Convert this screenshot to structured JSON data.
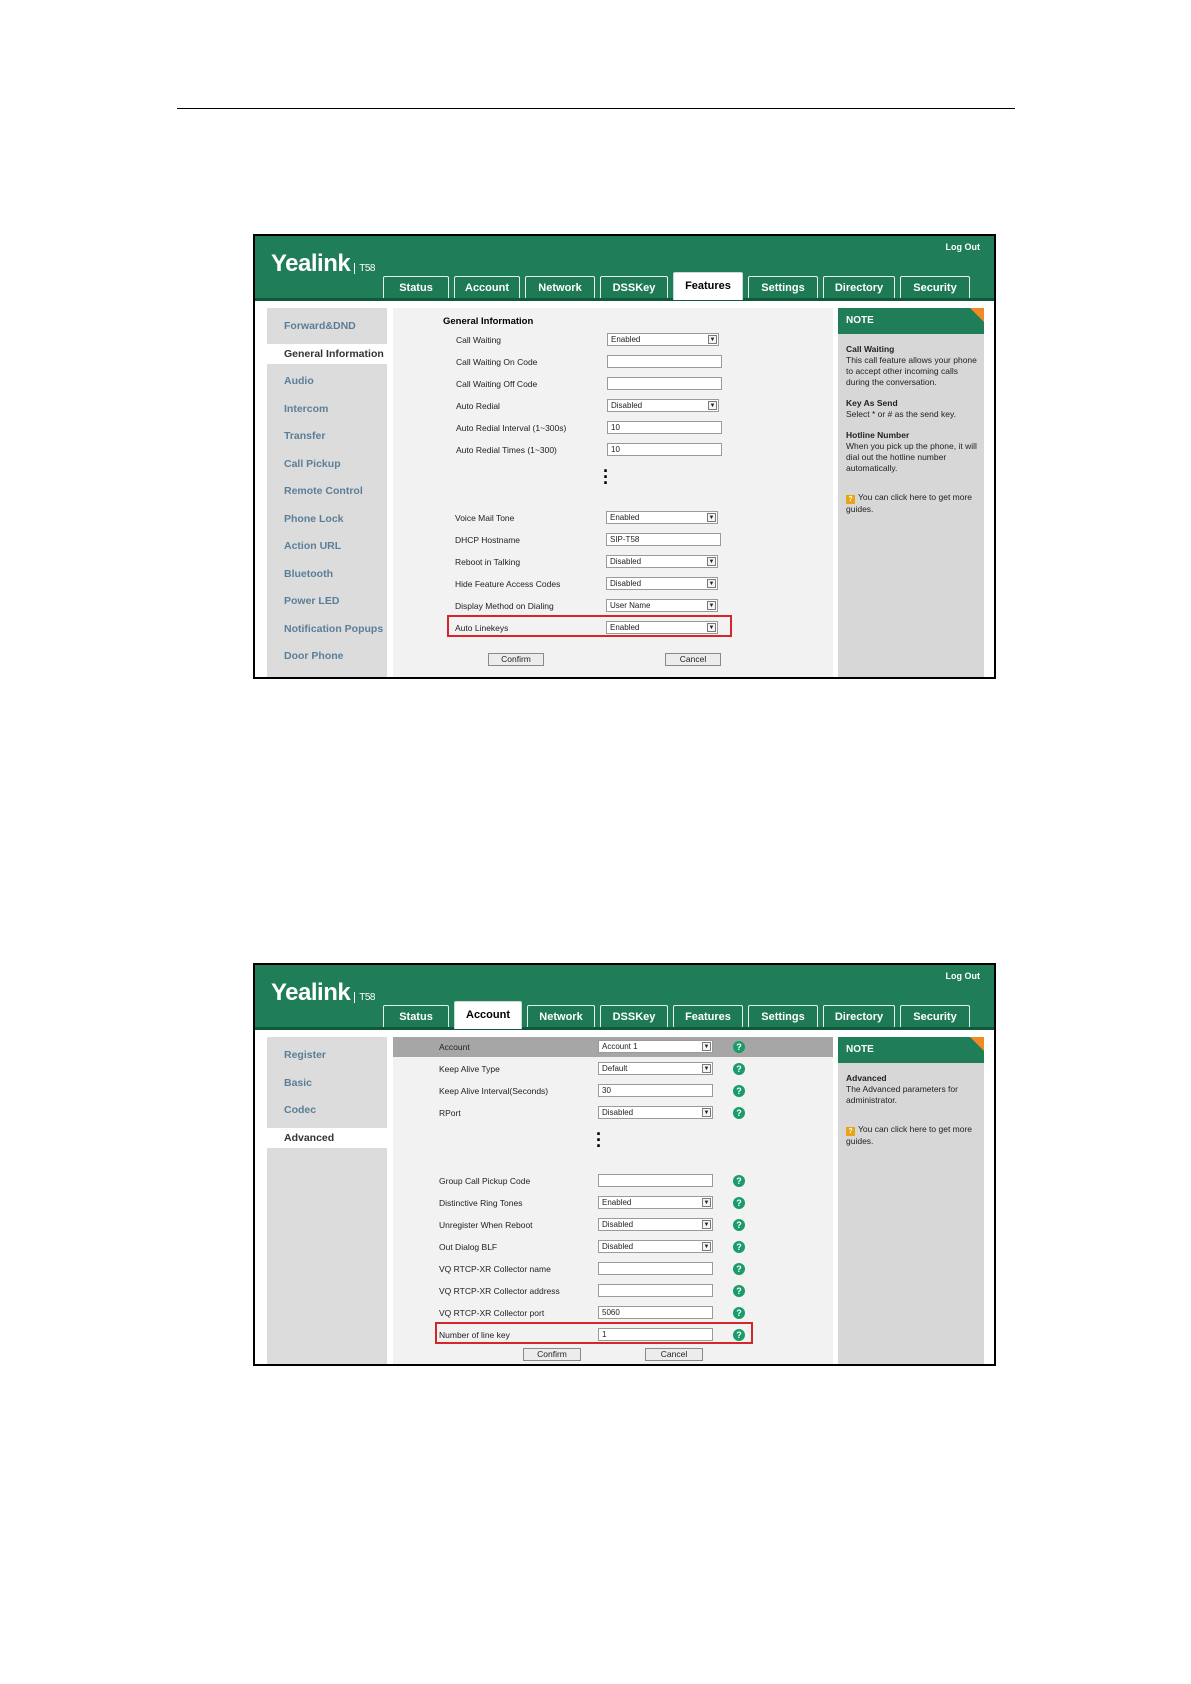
{
  "screenshot1": {
    "logo": "Yealink",
    "model": "T58",
    "logout": "Log Out",
    "tabs": [
      {
        "label": "Status"
      },
      {
        "label": "Account"
      },
      {
        "label": "Network"
      },
      {
        "label": "DSSKey"
      },
      {
        "label": "Features"
      },
      {
        "label": "Settings"
      },
      {
        "label": "Directory"
      },
      {
        "label": "Security"
      }
    ],
    "active_tab": "Features",
    "sidebar": [
      "Forward&DND",
      "General Information",
      "Audio",
      "Intercom",
      "Transfer",
      "Call Pickup",
      "Remote Control",
      "Phone Lock",
      "Action URL",
      "Bluetooth",
      "Power LED",
      "Notification Popups",
      "Door Phone"
    ],
    "sidebar_selected": "General Information",
    "section_title": "General Information",
    "rows": [
      {
        "label": "Call Waiting",
        "value": "Enabled",
        "type": "select"
      },
      {
        "label": "Call Waiting On Code",
        "value": "",
        "type": "input"
      },
      {
        "label": "Call Waiting Off Code",
        "value": "",
        "type": "input"
      },
      {
        "label": "Auto Redial",
        "value": "Disabled",
        "type": "select"
      },
      {
        "label": "Auto Redial Interval (1~300s)",
        "value": "10",
        "type": "input"
      },
      {
        "label": "Auto Redial Times (1~300)",
        "value": "10",
        "type": "input"
      },
      {
        "label": "Voice Mail Tone",
        "value": "Enabled",
        "type": "select"
      },
      {
        "label": "DHCP Hostname",
        "value": "SIP-T58",
        "type": "input"
      },
      {
        "label": "Reboot in Talking",
        "value": "Disabled",
        "type": "select"
      },
      {
        "label": "Hide Feature Access Codes",
        "value": "Disabled",
        "type": "select"
      },
      {
        "label": "Display Method on Dialing",
        "value": "User Name",
        "type": "select"
      },
      {
        "label": "Auto Linekeys",
        "value": "Enabled",
        "type": "select"
      }
    ],
    "confirm": "Confirm",
    "cancel": "Cancel",
    "note": {
      "title": "NOTE",
      "items": [
        {
          "title": "Call Waiting",
          "text": "This call feature allows your phone to accept other incoming calls during the conversation."
        },
        {
          "title": "Key As Send",
          "text": "Select * or # as the send key."
        },
        {
          "title": "Hotline Number",
          "text": "When you pick up the phone, it will dial out the hotline number automatically."
        }
      ],
      "guide": "You can click here to get more guides."
    }
  },
  "screenshot2": {
    "logo": "Yealink",
    "model": "T58",
    "logout": "Log Out",
    "tabs": [
      {
        "label": "Status"
      },
      {
        "label": "Account"
      },
      {
        "label": "Network"
      },
      {
        "label": "DSSKey"
      },
      {
        "label": "Features"
      },
      {
        "label": "Settings"
      },
      {
        "label": "Directory"
      },
      {
        "label": "Security"
      }
    ],
    "active_tab": "Account",
    "sidebar": [
      "Register",
      "Basic",
      "Codec",
      "Advanced"
    ],
    "sidebar_selected": "Advanced",
    "rows": [
      {
        "label": "Account",
        "value": "Account 1",
        "type": "select"
      },
      {
        "label": "Keep Alive Type",
        "value": "Default",
        "type": "select"
      },
      {
        "label": "Keep Alive Interval(Seconds)",
        "value": "30",
        "type": "input"
      },
      {
        "label": "RPort",
        "value": "Disabled",
        "type": "select"
      },
      {
        "label": "Group Call Pickup Code",
        "value": "",
        "type": "input"
      },
      {
        "label": "Distinctive Ring Tones",
        "value": "Enabled",
        "type": "select"
      },
      {
        "label": "Unregister When Reboot",
        "value": "Disabled",
        "type": "select"
      },
      {
        "label": "Out Dialog BLF",
        "value": "Disabled",
        "type": "select"
      },
      {
        "label": "VQ RTCP-XR Collector name",
        "value": "",
        "type": "input"
      },
      {
        "label": "VQ RTCP-XR Collector address",
        "value": "",
        "type": "input"
      },
      {
        "label": "VQ RTCP-XR Collector port",
        "value": "5060",
        "type": "input"
      },
      {
        "label": "Number of line key",
        "value": "1",
        "type": "input"
      }
    ],
    "confirm": "Confirm",
    "cancel": "Cancel",
    "note": {
      "title": "NOTE",
      "items": [
        {
          "title": "Advanced",
          "text": "The Advanced parameters for administrator."
        }
      ],
      "guide": "You can click here to get more guides."
    }
  }
}
